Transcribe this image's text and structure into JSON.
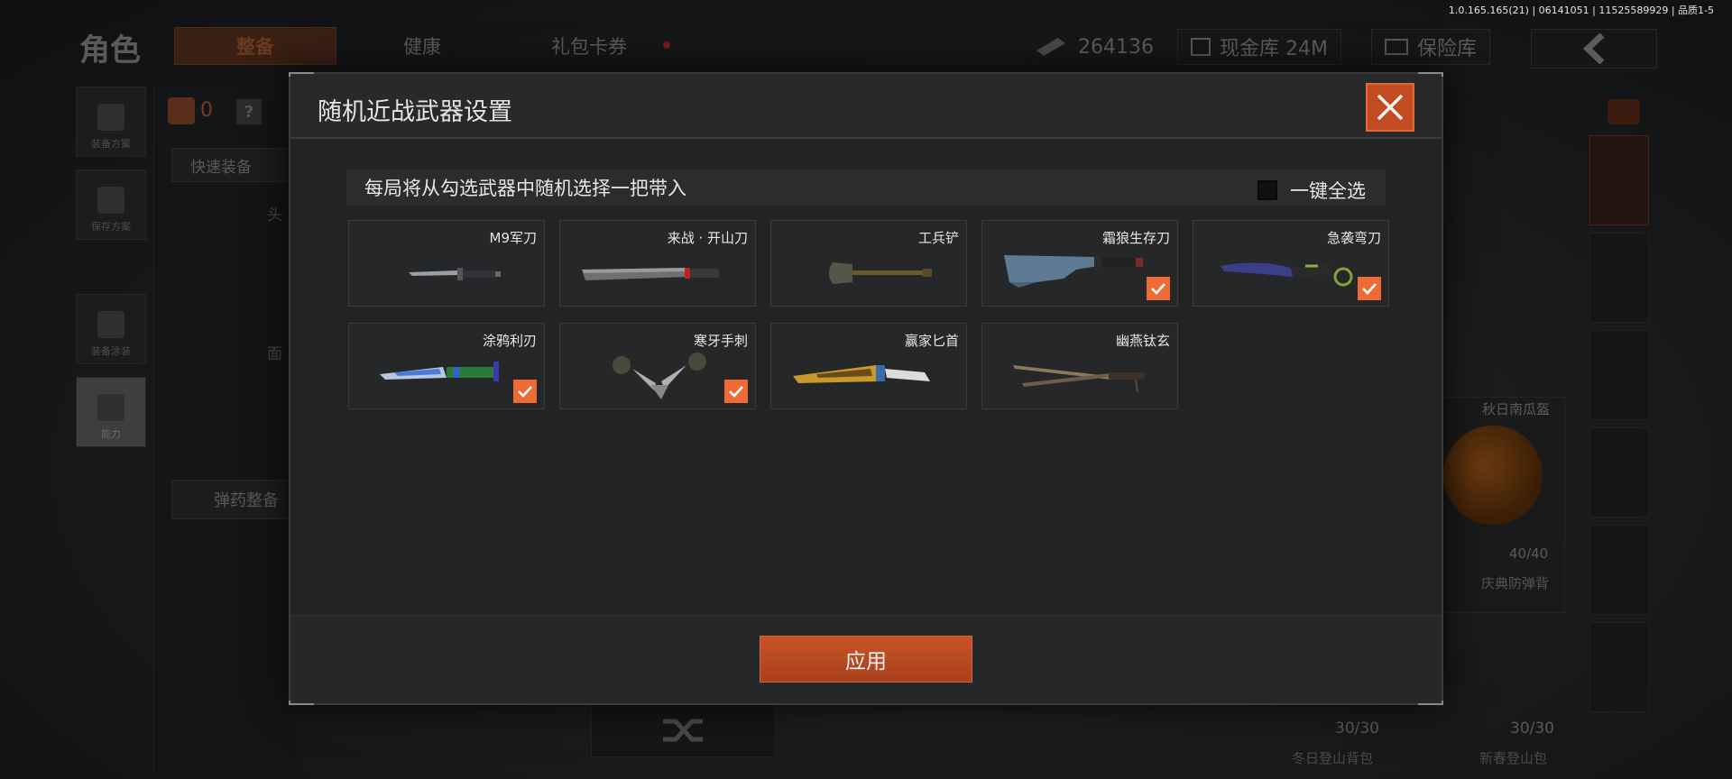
{
  "version_text": "1.0.165.165(21) | 06141051 | 11525589929 | 品质1-5",
  "header": {
    "title": "角色",
    "tabs": [
      {
        "label": "整备",
        "active": true
      },
      {
        "label": "健康",
        "active": false
      },
      {
        "label": "礼包卡券",
        "active": false
      }
    ],
    "currency_value": "264136",
    "cash_vault": "现金库 24M",
    "safe_vault": "保险库",
    "back_icon": "chevron-left-icon"
  },
  "left_sidebar": [
    {
      "label": "装备方案",
      "icon": "vest-icon"
    },
    {
      "label": "保存方案",
      "icon": "download-icon"
    },
    {
      "label": "装备涂装",
      "icon": "helmet-icon"
    },
    {
      "label": "能力",
      "icon": "lightning-icon",
      "active": true
    }
  ],
  "left_panel": {
    "armor_count": "0",
    "help_icon": "?",
    "quick_equip": "快速装备",
    "head_label": "头",
    "face_label": "面",
    "ammo_button": "弹药整备"
  },
  "right_panel": {
    "item1_name": "秋日南瓜盔",
    "item1_count": "40/40",
    "item2_name": "庆典防弹背",
    "bottom_count1": "30/30",
    "bottom_count2": "30/30",
    "bottom_name1": "冬日登山背包",
    "bottom_name2": "新春登山包"
  },
  "modal": {
    "title": "随机近战武器设置",
    "info_text": "每局将从勾选武器中随机选择一把带入",
    "select_all_label": "一键全选",
    "select_all_checked": false,
    "apply_label": "应用",
    "accent_color": "#f06a35",
    "weapons": [
      {
        "name": "M9军刀",
        "checked": false,
        "icon": "bayonet-icon"
      },
      {
        "name": "来战 · 开山刀",
        "checked": false,
        "icon": "machete-icon"
      },
      {
        "name": "工兵铲",
        "checked": false,
        "icon": "shovel-icon"
      },
      {
        "name": "霜狼生存刀",
        "checked": true,
        "icon": "survival-knife-icon"
      },
      {
        "name": "急袭弯刀",
        "checked": true,
        "icon": "karambit-icon"
      },
      {
        "name": "涂鸦利刃",
        "checked": true,
        "icon": "graffiti-blade-icon"
      },
      {
        "name": "寒牙手刺",
        "checked": true,
        "icon": "push-dagger-icon"
      },
      {
        "name": "赢家匕首",
        "checked": false,
        "icon": "gold-dagger-icon"
      },
      {
        "name": "幽燕钛玄",
        "checked": false,
        "icon": "twin-blade-icon"
      }
    ]
  }
}
